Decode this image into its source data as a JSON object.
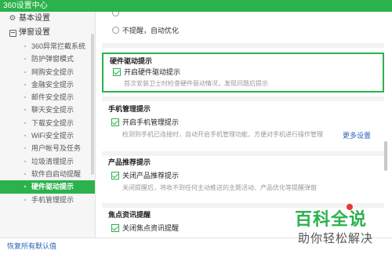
{
  "window": {
    "title": "360设置中心"
  },
  "sidebar": {
    "groups": [
      {
        "label": "基本设置",
        "icon": "gear-icon"
      },
      {
        "label": "弹窗设置",
        "icon": "popup-icon"
      }
    ],
    "items": [
      {
        "label": "360异常拦截系统"
      },
      {
        "label": "防护弹窗模式"
      },
      {
        "label": "网购安全提示"
      },
      {
        "label": "金融安全提示"
      },
      {
        "label": "邮件安全提示"
      },
      {
        "label": "聊天安全提示"
      },
      {
        "label": "下载安全提示"
      },
      {
        "label": "WiFi安全提示"
      },
      {
        "label": "用户帐号及任务"
      },
      {
        "label": "垃圾清理提示"
      },
      {
        "label": "软件自启动提醒"
      },
      {
        "label": "硬件驱动提示",
        "active": true
      },
      {
        "label": "手机管理提示"
      }
    ]
  },
  "footer": {
    "restore_label": "恢复所有默认值"
  },
  "main": {
    "top_options": [
      {
        "label": "不提醒，自动优化"
      }
    ],
    "sections": [
      {
        "title": "硬件驱动提示",
        "checkbox": "开启硬件驱动提示",
        "description": "首次安装卫士时检查硬件驱动情况，发现问题后提示",
        "highlighted": true
      },
      {
        "title": "手机管理提示",
        "checkbox": "开启手机管理提示",
        "description": "检测到手机已连接时，自动开启手机管理功能，方便对手机进行操作管理",
        "link": "更多设置"
      },
      {
        "title": "产品推荐提示",
        "checkbox": "关闭产品推荐提示",
        "description": "关闭提醒后，将收不到任何主动推送的主题活动、产品优化等提醒弹窗"
      },
      {
        "title": "焦点资讯提醒",
        "checkbox": "关闭焦点资讯提醒"
      }
    ]
  },
  "watermark": {
    "line1": "百科全说",
    "line2": "助你轻松解决"
  },
  "colors": {
    "accent": "#2bb24c",
    "link": "#2a62b8",
    "muted": "#999999"
  }
}
